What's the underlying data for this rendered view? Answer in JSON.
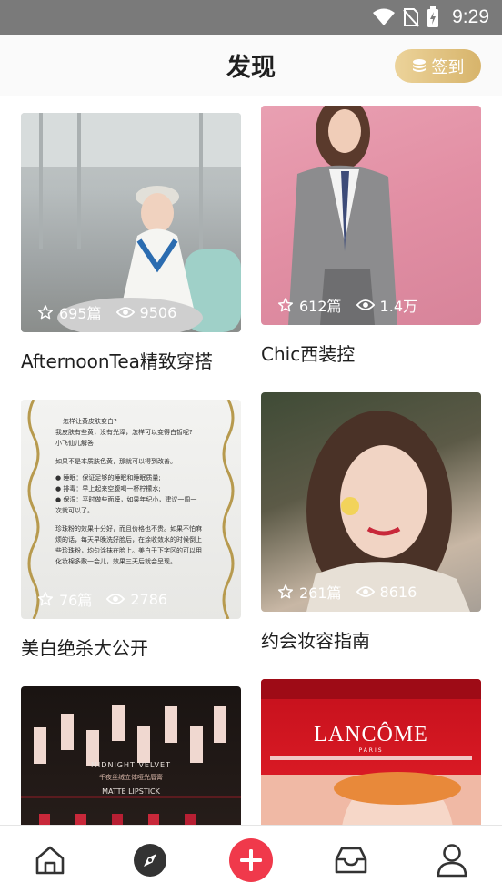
{
  "status_bar": {
    "time": "9:29",
    "icons": [
      "wifi-icon",
      "no-sim-icon",
      "battery-charging-icon"
    ]
  },
  "header": {
    "title": "发现",
    "checkin_label": "签到",
    "checkin_icon": "coin-stack-icon"
  },
  "cards": [
    {
      "caption": "AfternoonTea精致穿搭",
      "articles": "695篇",
      "views": "9506"
    },
    {
      "caption": "Chic西装控",
      "articles": "612篇",
      "views": "1.4万"
    },
    {
      "caption": "美白绝杀大公开",
      "articles": "76篇",
      "views": "2786"
    },
    {
      "caption": "约会妆容指南",
      "articles": "261篇",
      "views": "8616"
    },
    {
      "caption": "",
      "articles": "",
      "views": ""
    },
    {
      "caption": "",
      "articles": "",
      "views": ""
    }
  ],
  "doc_lines": [
    "怎样让黄皮肤变白?",
    "我皮肤有些黄，没有光泽，怎样可以变得白皙呢?",
    "小飞仙儿解答",
    "如果不是本质肤色黄，那就可以得到改善。",
    "● 睡眠：保证足够的睡眠和睡眠质量;",
    "● 排毒：早上起来空腹喝一杯柠檬水;",
    "● 保湿：平时做些面膜，如果年纪小，建议一周一",
    "次就可以了。",
    "珍珠粉的效果十分好，而且价格也不贵。如果不怕麻",
    "烦的话，每天早晚洗好脸后，在涂收敛水的时候倒上",
    "些珍珠粉，均匀涂抹在脸上。美白于下字区的可以用",
    "化妆棉多敷一会儿，效果三天后就会呈现。"
  ],
  "lipstick_text": {
    "line1": "MIDNIGHT VELVET",
    "line2": "千夜丝绒立体哑光唇膏",
    "line3": "MATTE LIPSTICK"
  },
  "lancome_text": {
    "brand": "LANCÔME",
    "sub": "PARIS"
  },
  "nav": [
    {
      "label": "home",
      "icon": "home-icon"
    },
    {
      "label": "discover",
      "icon": "compass-icon"
    },
    {
      "label": "publish",
      "icon": "plus-icon"
    },
    {
      "label": "messages",
      "icon": "inbox-icon"
    },
    {
      "label": "profile",
      "icon": "user-icon"
    }
  ],
  "colors": {
    "accent_red": "#f0394b",
    "gold_start": "#ecd39a",
    "gold_end": "#d7b46b",
    "status_bar": "#7a7a7a"
  }
}
